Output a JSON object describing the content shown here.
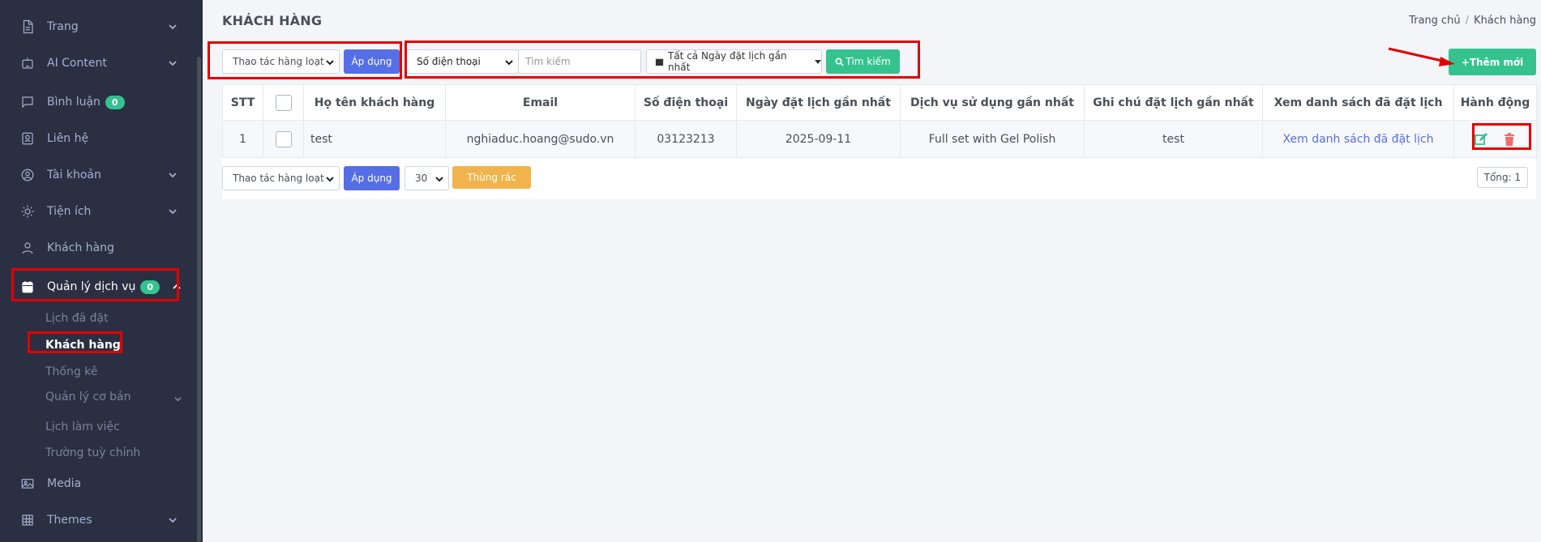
{
  "sidebar": {
    "items": [
      {
        "label": "Trang",
        "icon": "file-icon"
      },
      {
        "label": "AI Content",
        "icon": "robot-icon"
      },
      {
        "label": "Bình luận",
        "icon": "comment-icon",
        "badge": "0"
      },
      {
        "label": "Liên hệ",
        "icon": "contact-icon"
      },
      {
        "label": "Tài khoản",
        "icon": "user-circle-icon"
      },
      {
        "label": "Tiện ích",
        "icon": "sun-icon"
      },
      {
        "label": "Khách hàng",
        "icon": "user-icon"
      },
      {
        "label": "Quản lý dịch vụ",
        "icon": "calendar-icon",
        "badge": "0"
      },
      {
        "label": "Media",
        "icon": "image-icon"
      },
      {
        "label": "Themes",
        "icon": "grid-icon"
      }
    ],
    "subitems": [
      "Lịch đã đặt",
      "Khách hàng",
      "Thống kê",
      "Quản lý cơ bản",
      "Lịch làm việc",
      "Trường tuỳ chỉnh"
    ]
  },
  "header": {
    "title": "KHÁCH HÀNG",
    "breadcrumb": [
      "Trang chủ",
      "Khách hàng"
    ]
  },
  "toolbar": {
    "bulk_action": "Thao tác hàng loạt",
    "apply_label": "Áp dụng",
    "field_select": "Số điện thoại",
    "search_placeholder": "Tìm kiếm",
    "date_filter": "Tất cả Ngày đặt lịch gần nhất",
    "search_button": "Tìm kiếm",
    "add_button": "+Thêm mới"
  },
  "table": {
    "columns": [
      "STT",
      "",
      "Họ tên khách hàng",
      "Email",
      "Số điện thoại",
      "Ngày đặt lịch gần nhất",
      "Dịch vụ sử dụng gần nhất",
      "Ghi chú đặt lịch gần nhất",
      "Xem danh sách đã đặt lịch",
      "Hành động"
    ],
    "rows": [
      {
        "stt": "1",
        "name": "test",
        "email": "nghiaduc.hoang@sudo.vn",
        "phone": "03123213",
        "date": "2025-09-11",
        "service": "Full set with Gel Polish",
        "note": "test",
        "view_link": "Xem danh sách đã đặt lịch"
      }
    ]
  },
  "footer": {
    "bulk_action": "Thao tác hàng loạt",
    "apply_label": "Áp dụng",
    "per_page": "30",
    "trash_label": "Thùng rác",
    "total_label": "Tổng: 1"
  },
  "colors": {
    "sidebar_bg": "#2a3042",
    "primary": "#556ee6",
    "success": "#34c38f",
    "warning": "#f1b44c",
    "danger": "#e10000"
  }
}
